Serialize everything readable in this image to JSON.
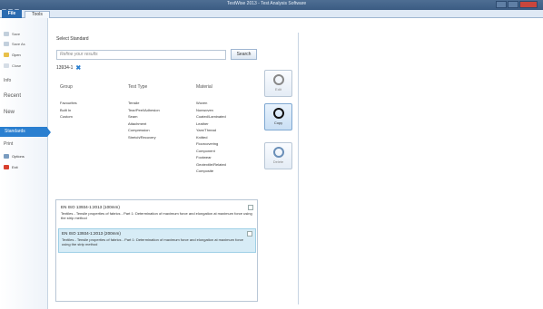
{
  "window": {
    "title": "TestWise 2013 - Test Analysis Software"
  },
  "ribbon": {
    "tabs": [
      "File",
      "Tools"
    ]
  },
  "sidebar": {
    "items": [
      {
        "label": "Save"
      },
      {
        "label": "Save As"
      },
      {
        "label": "Open"
      },
      {
        "label": "Close"
      }
    ],
    "sections": [
      "Info",
      "Recent",
      "New",
      "Standards",
      "Print"
    ],
    "bottom_items": [
      {
        "label": "Options"
      },
      {
        "label": "Exit"
      }
    ]
  },
  "main": {
    "panel_title": "Select Standard",
    "search": {
      "placeholder": "Refine your results",
      "button_label": "Search"
    },
    "selected_standard": "13934-1",
    "columns": {
      "group": {
        "header": "Group",
        "items": [
          "Favourites",
          "Built In",
          "Custom"
        ]
      },
      "test_type": {
        "header": "Test Type",
        "items": [
          "Tensile",
          "Tear/Peel/Adhesion",
          "Seam",
          "Attachment",
          "Compression",
          "Stretch/Recovery"
        ]
      },
      "material": {
        "header": "Material",
        "items": [
          "Woven",
          "Nonwoven",
          "Coated/Laminated",
          "Leather",
          "Yarn/Thread",
          "Knitted",
          "Floorcovering",
          "Component",
          "Footwear",
          "Geotextile/Related",
          "Composite"
        ]
      }
    },
    "actions": [
      {
        "label": "Edit",
        "icon": "edit-icon"
      },
      {
        "label": "Copy",
        "icon": "copy-icon"
      },
      {
        "label": "Delete",
        "icon": "delete-icon"
      }
    ],
    "results": [
      {
        "name": "EN ISO 13934-1:2013 (100mm)",
        "description": "Textiles - Tensile properties of fabrics - Part 1: Determination of maximum force and elongation at maximum force using the strip method"
      },
      {
        "name": "EN ISO 13934-1:2013 (200mm)",
        "description": "Textiles - Tensile properties of fabrics - Part 1: Determination of maximum force and elongation at maximum force using the strip method"
      }
    ]
  },
  "colors": {
    "accent": "#2a7fd0",
    "title_bar": "#3b5c83",
    "selected_row": "#d7ecf6"
  }
}
